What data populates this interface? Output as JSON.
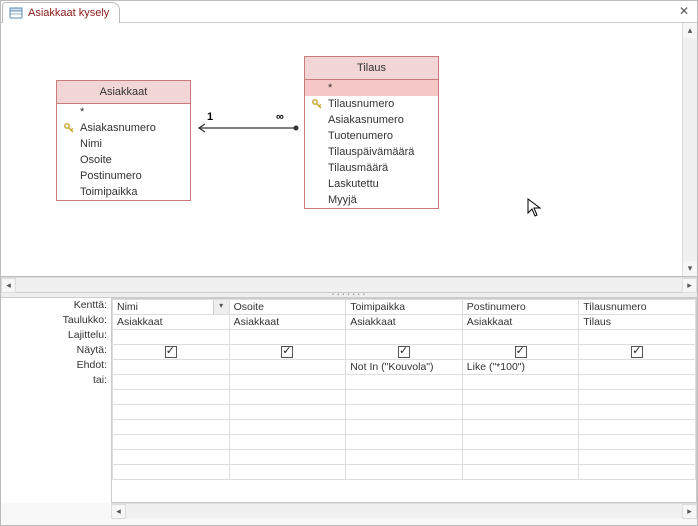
{
  "tab": {
    "title": "Asiakkaat kysely"
  },
  "tables": {
    "left": {
      "title": "Asiakkaat",
      "star": "*",
      "fields": [
        "Asiakasnumero",
        "Nimi",
        "Osoite",
        "Postinumero",
        "Toimipaikka"
      ],
      "keyIndex": 0
    },
    "right": {
      "title": "Tilaus",
      "star": "*",
      "fields": [
        "Tilausnumero",
        "Asiakasnumero",
        "Tuotenumero",
        "Tilauspäivämäärä",
        "Tilausmäärä",
        "Laskutettu",
        "Myyjä"
      ],
      "keyIndex": 0
    }
  },
  "relationship": {
    "leftLabel": "1",
    "rightLabel": "∞"
  },
  "gridLabels": {
    "field": "Kenttä:",
    "table": "Taulukko:",
    "sort": "Lajittelu:",
    "show": "Näytä:",
    "criteria": "Ehdot:",
    "or": "tai:"
  },
  "columns": [
    {
      "field": "Nimi",
      "table": "Asiakkaat",
      "show": true,
      "criteria": "",
      "active": true
    },
    {
      "field": "Osoite",
      "table": "Asiakkaat",
      "show": true,
      "criteria": ""
    },
    {
      "field": "Toimipaikka",
      "table": "Asiakkaat",
      "show": true,
      "criteria": "Not In (\"Kouvola\")"
    },
    {
      "field": "Postinumero",
      "table": "Asiakkaat",
      "show": true,
      "criteria": "Like (\"*100\")"
    },
    {
      "field": "Tilausnumero",
      "table": "Tilaus",
      "show": true,
      "criteria": ""
    }
  ]
}
